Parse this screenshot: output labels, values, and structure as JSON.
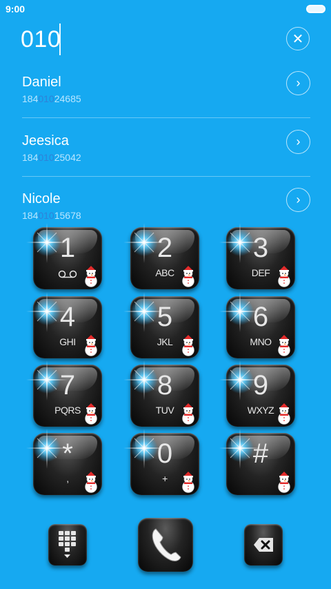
{
  "status_bar": {
    "time": "9:00"
  },
  "search": {
    "query": "010"
  },
  "contacts": [
    {
      "name": "Daniel",
      "number_prefix": "184",
      "number_match": "010",
      "number_suffix": "24685"
    },
    {
      "name": "Jeesica",
      "number_prefix": "184",
      "number_match": "010",
      "number_suffix": "25042"
    },
    {
      "name": "Nicole",
      "number_prefix": "184",
      "number_match": "010",
      "number_suffix": "15678"
    }
  ],
  "keypad": [
    {
      "digit": "1",
      "letters": ""
    },
    {
      "digit": "2",
      "letters": "ABC"
    },
    {
      "digit": "3",
      "letters": "DEF"
    },
    {
      "digit": "4",
      "letters": "GHI"
    },
    {
      "digit": "5",
      "letters": "JKL"
    },
    {
      "digit": "6",
      "letters": "MNO"
    },
    {
      "digit": "7",
      "letters": "PQRS"
    },
    {
      "digit": "8",
      "letters": "TUV"
    },
    {
      "digit": "9",
      "letters": "WXYZ"
    },
    {
      "digit": "*",
      "letters": ","
    },
    {
      "digit": "0",
      "letters": "+"
    },
    {
      "digit": "#",
      "letters": ""
    }
  ],
  "icons": {
    "clear": "close-icon",
    "contact_action": "chevron-right-icon",
    "voicemail": "voicemail-icon",
    "dialpad_toggle": "dialpad-icon",
    "call": "phone-handset-icon",
    "backspace": "backspace-icon",
    "key_decoration": "snowman-icon"
  },
  "colors": {
    "background": "#16a9f1",
    "match_highlight": "#2f82d8",
    "key_face": "#111111"
  }
}
